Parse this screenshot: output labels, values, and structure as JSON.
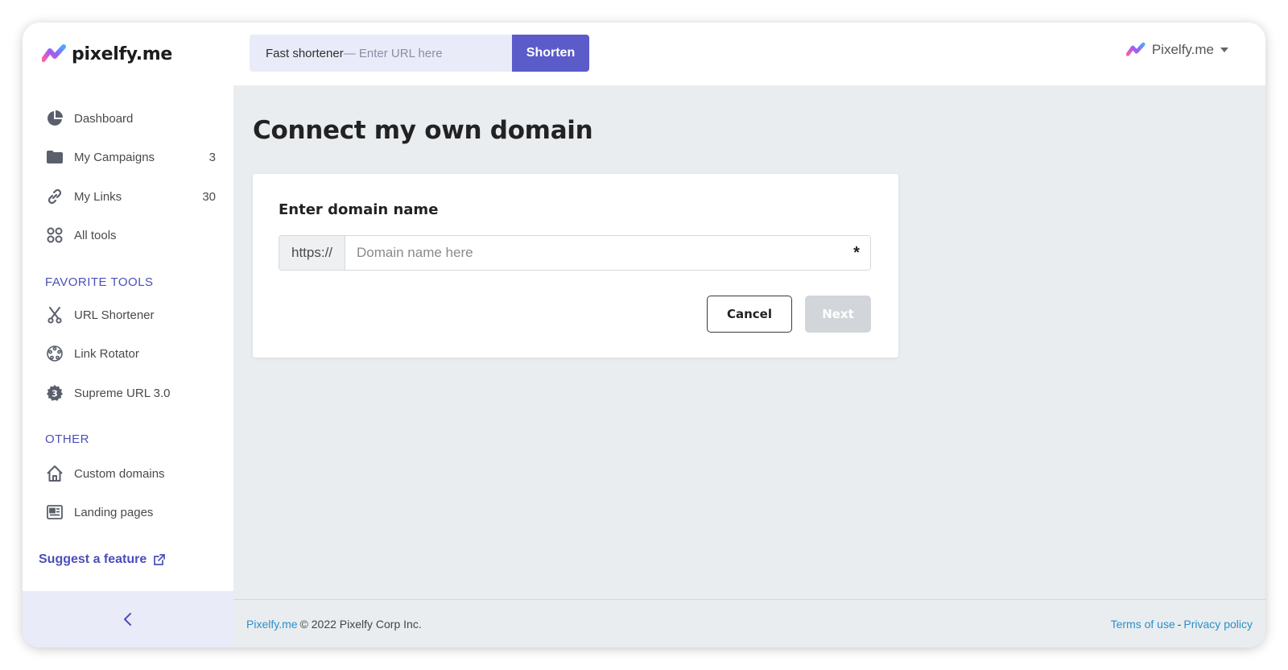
{
  "brand": {
    "logo_text": "pixelfy.me",
    "colors": {
      "accent": "#5b5cc9",
      "link": "#2c8fc9",
      "section": "#4b4fb8"
    }
  },
  "header": {
    "shortener_label": "Fast shortener",
    "shortener_placeholder": "— Enter URL here",
    "shorten_button": "Shorten",
    "account_name": "Pixelfy.me"
  },
  "sidebar": {
    "items": [
      {
        "label": "Dashboard",
        "icon": "pie-chart-icon",
        "count": ""
      },
      {
        "label": "My Campaigns",
        "icon": "folder-icon",
        "count": "3"
      },
      {
        "label": "My Links",
        "icon": "link-icon",
        "count": "30"
      },
      {
        "label": "All tools",
        "icon": "grid-icon",
        "count": ""
      }
    ],
    "favorite_title": "FAVORITE TOOLS",
    "favorites": [
      {
        "label": "URL Shortener",
        "icon": "scissors-icon"
      },
      {
        "label": "Link Rotator",
        "icon": "rotator-icon"
      },
      {
        "label": "Supreme URL 3.0",
        "icon": "badge-3-icon"
      }
    ],
    "other_title": "OTHER",
    "other": [
      {
        "label": "Custom domains",
        "icon": "home-icon"
      },
      {
        "label": "Landing pages",
        "icon": "newspaper-icon"
      }
    ],
    "suggest_label": "Suggest a feature"
  },
  "main": {
    "page_title": "Connect my own domain",
    "card_title": "Enter domain name",
    "domain_prefix": "https://",
    "domain_placeholder": "Domain name here",
    "required_mark": "*",
    "cancel_label": "Cancel",
    "next_label": "Next"
  },
  "footer": {
    "brand_link": "Pixelfy.me",
    "copyright": "© 2022 Pixelfy Corp Inc.",
    "terms": "Terms of use",
    "separator": "-",
    "privacy": "Privacy policy"
  }
}
